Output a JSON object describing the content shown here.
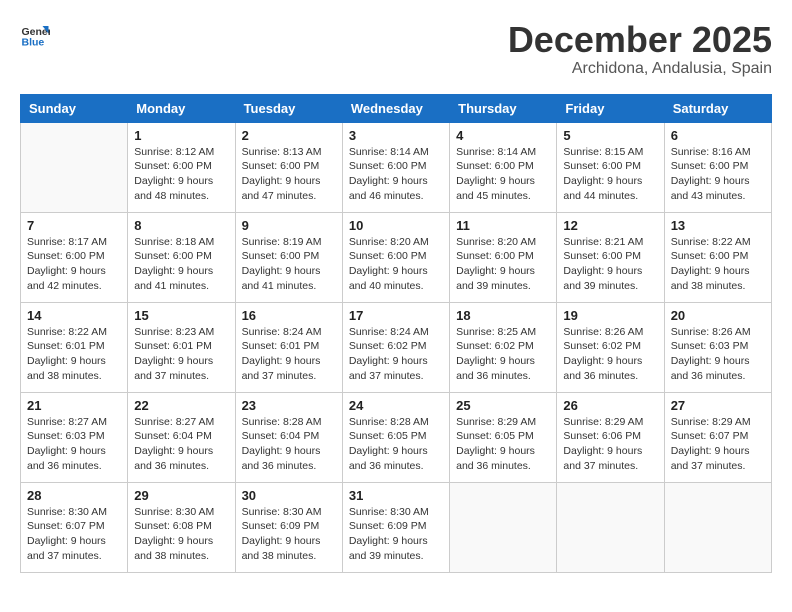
{
  "logo": {
    "line1": "General",
    "line2": "Blue"
  },
  "title": "December 2025",
  "subtitle": "Archidona, Andalusia, Spain",
  "days_header": [
    "Sunday",
    "Monday",
    "Tuesday",
    "Wednesday",
    "Thursday",
    "Friday",
    "Saturday"
  ],
  "weeks": [
    [
      {
        "num": "",
        "info": ""
      },
      {
        "num": "1",
        "info": "Sunrise: 8:12 AM\nSunset: 6:00 PM\nDaylight: 9 hours\nand 48 minutes."
      },
      {
        "num": "2",
        "info": "Sunrise: 8:13 AM\nSunset: 6:00 PM\nDaylight: 9 hours\nand 47 minutes."
      },
      {
        "num": "3",
        "info": "Sunrise: 8:14 AM\nSunset: 6:00 PM\nDaylight: 9 hours\nand 46 minutes."
      },
      {
        "num": "4",
        "info": "Sunrise: 8:14 AM\nSunset: 6:00 PM\nDaylight: 9 hours\nand 45 minutes."
      },
      {
        "num": "5",
        "info": "Sunrise: 8:15 AM\nSunset: 6:00 PM\nDaylight: 9 hours\nand 44 minutes."
      },
      {
        "num": "6",
        "info": "Sunrise: 8:16 AM\nSunset: 6:00 PM\nDaylight: 9 hours\nand 43 minutes."
      }
    ],
    [
      {
        "num": "7",
        "info": "Sunrise: 8:17 AM\nSunset: 6:00 PM\nDaylight: 9 hours\nand 42 minutes."
      },
      {
        "num": "8",
        "info": "Sunrise: 8:18 AM\nSunset: 6:00 PM\nDaylight: 9 hours\nand 41 minutes."
      },
      {
        "num": "9",
        "info": "Sunrise: 8:19 AM\nSunset: 6:00 PM\nDaylight: 9 hours\nand 41 minutes."
      },
      {
        "num": "10",
        "info": "Sunrise: 8:20 AM\nSunset: 6:00 PM\nDaylight: 9 hours\nand 40 minutes."
      },
      {
        "num": "11",
        "info": "Sunrise: 8:20 AM\nSunset: 6:00 PM\nDaylight: 9 hours\nand 39 minutes."
      },
      {
        "num": "12",
        "info": "Sunrise: 8:21 AM\nSunset: 6:00 PM\nDaylight: 9 hours\nand 39 minutes."
      },
      {
        "num": "13",
        "info": "Sunrise: 8:22 AM\nSunset: 6:00 PM\nDaylight: 9 hours\nand 38 minutes."
      }
    ],
    [
      {
        "num": "14",
        "info": "Sunrise: 8:22 AM\nSunset: 6:01 PM\nDaylight: 9 hours\nand 38 minutes."
      },
      {
        "num": "15",
        "info": "Sunrise: 8:23 AM\nSunset: 6:01 PM\nDaylight: 9 hours\nand 37 minutes."
      },
      {
        "num": "16",
        "info": "Sunrise: 8:24 AM\nSunset: 6:01 PM\nDaylight: 9 hours\nand 37 minutes."
      },
      {
        "num": "17",
        "info": "Sunrise: 8:24 AM\nSunset: 6:02 PM\nDaylight: 9 hours\nand 37 minutes."
      },
      {
        "num": "18",
        "info": "Sunrise: 8:25 AM\nSunset: 6:02 PM\nDaylight: 9 hours\nand 36 minutes."
      },
      {
        "num": "19",
        "info": "Sunrise: 8:26 AM\nSunset: 6:02 PM\nDaylight: 9 hours\nand 36 minutes."
      },
      {
        "num": "20",
        "info": "Sunrise: 8:26 AM\nSunset: 6:03 PM\nDaylight: 9 hours\nand 36 minutes."
      }
    ],
    [
      {
        "num": "21",
        "info": "Sunrise: 8:27 AM\nSunset: 6:03 PM\nDaylight: 9 hours\nand 36 minutes."
      },
      {
        "num": "22",
        "info": "Sunrise: 8:27 AM\nSunset: 6:04 PM\nDaylight: 9 hours\nand 36 minutes."
      },
      {
        "num": "23",
        "info": "Sunrise: 8:28 AM\nSunset: 6:04 PM\nDaylight: 9 hours\nand 36 minutes."
      },
      {
        "num": "24",
        "info": "Sunrise: 8:28 AM\nSunset: 6:05 PM\nDaylight: 9 hours\nand 36 minutes."
      },
      {
        "num": "25",
        "info": "Sunrise: 8:29 AM\nSunset: 6:05 PM\nDaylight: 9 hours\nand 36 minutes."
      },
      {
        "num": "26",
        "info": "Sunrise: 8:29 AM\nSunset: 6:06 PM\nDaylight: 9 hours\nand 37 minutes."
      },
      {
        "num": "27",
        "info": "Sunrise: 8:29 AM\nSunset: 6:07 PM\nDaylight: 9 hours\nand 37 minutes."
      }
    ],
    [
      {
        "num": "28",
        "info": "Sunrise: 8:30 AM\nSunset: 6:07 PM\nDaylight: 9 hours\nand 37 minutes."
      },
      {
        "num": "29",
        "info": "Sunrise: 8:30 AM\nSunset: 6:08 PM\nDaylight: 9 hours\nand 38 minutes."
      },
      {
        "num": "30",
        "info": "Sunrise: 8:30 AM\nSunset: 6:09 PM\nDaylight: 9 hours\nand 38 minutes."
      },
      {
        "num": "31",
        "info": "Sunrise: 8:30 AM\nSunset: 6:09 PM\nDaylight: 9 hours\nand 39 minutes."
      },
      {
        "num": "",
        "info": ""
      },
      {
        "num": "",
        "info": ""
      },
      {
        "num": "",
        "info": ""
      }
    ]
  ]
}
